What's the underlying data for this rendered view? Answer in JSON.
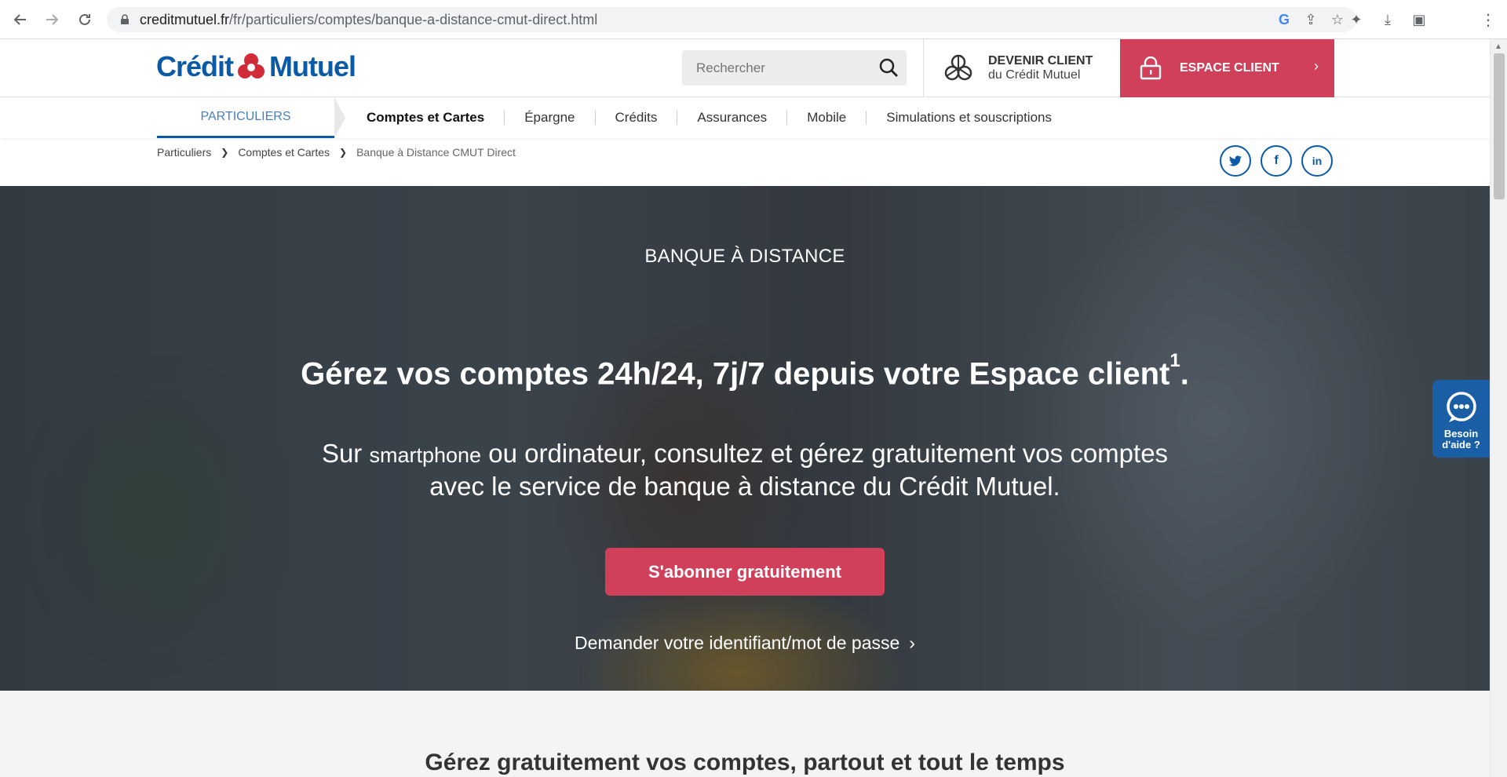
{
  "browser": {
    "url_host": "creditmutuel.fr",
    "url_path": "/fr/particuliers/comptes/banque-a-distance-cmut-direct.html"
  },
  "header": {
    "logo_part1": "Crédit",
    "logo_part2": "Mutuel",
    "search_placeholder": "Rechercher",
    "devenir_title": "DEVENIR CLIENT",
    "devenir_sub": "du Crédit Mutuel",
    "espace_label": "ESPACE CLIENT",
    "espace_chevron": "›"
  },
  "nav": {
    "active": "PARTICULIERS",
    "items": [
      "Comptes et Cartes",
      "Épargne",
      "Crédits",
      "Assurances",
      "Mobile",
      "Simulations et souscriptions"
    ]
  },
  "breadcrumb": {
    "items": [
      "Particuliers",
      "Comptes et Cartes",
      "Banque à Distance CMUT Direct"
    ]
  },
  "hero": {
    "kicker": "BANQUE À DISTANCE",
    "headline": "Gérez vos comptes 24h/24, 7j/7 depuis votre Espace client",
    "headline_sup": "1",
    "headline_end": ".",
    "sub_1": "Sur ",
    "sub_small": "smartphone",
    "sub_2": " ou ordinateur, consultez et gérez gratuitement vos comptes",
    "sub_3": "avec le service de banque à distance du Crédit Mutuel.",
    "cta": "S'abonner gratuitement",
    "link": "Demander votre identifiant/mot de passe"
  },
  "help": {
    "label_1": "Besoin",
    "label_2": "d'aide ?"
  },
  "lower": {
    "title": "Gérez gratuitement vos comptes, partout et tout le temps"
  },
  "colors": {
    "brand_blue": "#0b5aa8",
    "accent_red": "#d1405a"
  }
}
